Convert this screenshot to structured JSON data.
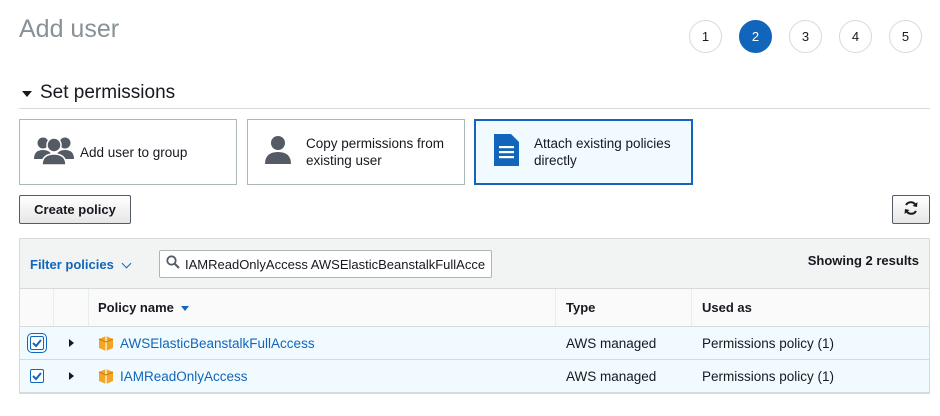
{
  "header": {
    "title": "Add user"
  },
  "steps": [
    {
      "label": "1",
      "active": false
    },
    {
      "label": "2",
      "active": true
    },
    {
      "label": "3",
      "active": false
    },
    {
      "label": "4",
      "active": false
    },
    {
      "label": "5",
      "active": false
    }
  ],
  "section": {
    "title": "Set permissions"
  },
  "options": [
    {
      "label": "Add user to group",
      "icon": "users-group-icon",
      "selected": false
    },
    {
      "label_line1": "Copy permissions from",
      "label_line2": "existing user",
      "icon": "user-icon",
      "selected": false
    },
    {
      "label_line1": "Attach existing policies",
      "label_line2": "directly",
      "icon": "document-icon",
      "selected": true
    }
  ],
  "toolbar": {
    "create_policy_label": "Create policy",
    "refresh_icon": "refresh-icon"
  },
  "filter": {
    "label": "Filter policies",
    "search_value": "IAMReadOnlyAccess AWSElasticBeanstalkFullAccess",
    "results_text": "Showing 2 results"
  },
  "table": {
    "columns": {
      "name": "Policy name",
      "type": "Type",
      "used_as": "Used as"
    },
    "rows": [
      {
        "name": "AWSElasticBeanstalkFullAccess",
        "type": "AWS managed",
        "used_as": "Permissions policy (1)",
        "checked": true
      },
      {
        "name": "IAMReadOnlyAccess",
        "type": "AWS managed",
        "used_as": "Permissions policy (1)",
        "checked": true
      }
    ]
  },
  "colors": {
    "accent": "#1166bb",
    "selected_bg": "#f1faff",
    "policy_icon": "#f4a523"
  }
}
